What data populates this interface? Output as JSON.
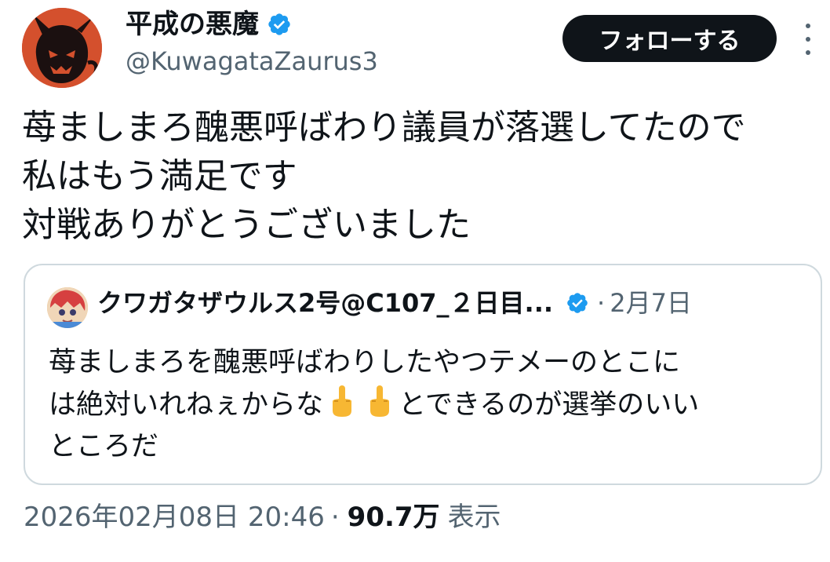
{
  "author": {
    "display_name": "平成の悪魔",
    "handle": "@KuwagataZaurus3",
    "verified_icon": "verified-badge-icon",
    "avatar_icon": "devil-avatar-icon"
  },
  "actions": {
    "follow_label": "フォローする",
    "more_icon": "more-dots-icon"
  },
  "tweet": {
    "text": "苺ましまろ醜悪呼ばわり議員が落選してたので\n私はもう満足です\n対戦ありがとうございました"
  },
  "quote": {
    "name": "クワガタザウルス2号@C107_２日目...",
    "separator": "·",
    "date": "2月7日",
    "text_part1": "苺ましまろを醜悪呼ばわりしたやつテメーのとこに\nは絶対いれねぇからな",
    "emoji": "middle-finger-emoji",
    "text_part2": "とできるのが選挙のいい\nところだ"
  },
  "meta": {
    "timestamp": "2026年02月08日 20:46",
    "dot": "·",
    "views_count": "90.7万",
    "views_label": "表示"
  },
  "colors": {
    "text_primary": "#0f1419",
    "text_secondary": "#536471",
    "verified_blue": "#1d9bf0",
    "border": "#cfd9de",
    "button_bg": "#0f1419"
  }
}
